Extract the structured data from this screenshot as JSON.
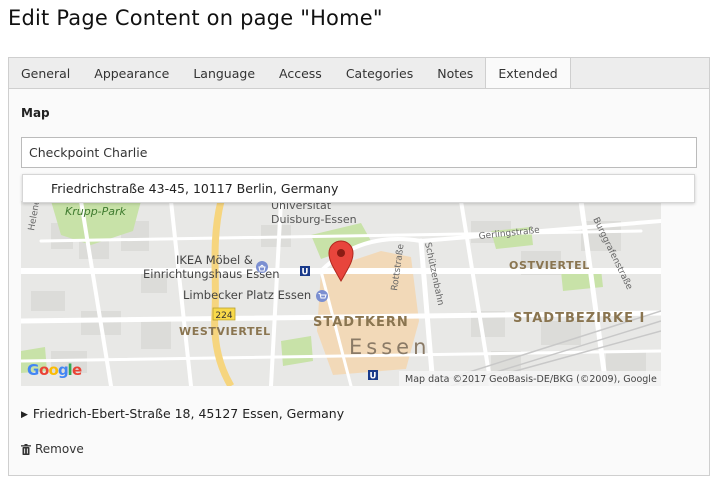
{
  "page": {
    "title": "Edit Page Content on page \"Home\""
  },
  "tabs": [
    {
      "label": "General",
      "active": false
    },
    {
      "label": "Appearance",
      "active": false
    },
    {
      "label": "Language",
      "active": false
    },
    {
      "label": "Access",
      "active": false
    },
    {
      "label": "Categories",
      "active": false
    },
    {
      "label": "Notes",
      "active": false
    },
    {
      "label": "Extended",
      "active": true
    }
  ],
  "map_field": {
    "label": "Map",
    "search_value": "Checkpoint Charlie",
    "suggestion": "Friedrichstraße 43-45, 10117 Berlin, Germany",
    "map": {
      "labels": {
        "krupp": "Krupp-Park",
        "helenen": "Helenen",
        "uni1": "Universität",
        "uni2": "Duisburg-Essen",
        "ikea1": "IKEA Möbel &",
        "ikea2": "Einrichtungshaus Essen",
        "limbecker": "Limbecker Platz Essen",
        "westviertel": "WESTVIERTEL",
        "stadtkern": "STADTKERN",
        "essen": "Essen",
        "ostviertel": "OSTVIERTEL",
        "stadtbezirke": "STADTBEZIRKE I",
        "gerling": "Gerlingstraße",
        "burggrafen": "Burggrafenstraße",
        "rott": "Rottstraße",
        "schuetzen": "Schützenbahn",
        "road224": "224",
        "ubahn": "U"
      },
      "logo": {
        "letters": [
          "G",
          "o",
          "o",
          "g",
          "l",
          "e"
        ]
      },
      "attribution": "Map data ©2017 GeoBasis-DE/BKG (©2009), Google"
    },
    "address": "Friedrich-Ebert-Straße 18, 45127 Essen, Germany",
    "remove_label": "Remove"
  },
  "colors": {
    "map_background": "#e8e8e6",
    "park": "#c8e2a8",
    "city_center": "#f2d9b8",
    "marker": "#e8453c",
    "road_yellow": "#f6d57e"
  }
}
